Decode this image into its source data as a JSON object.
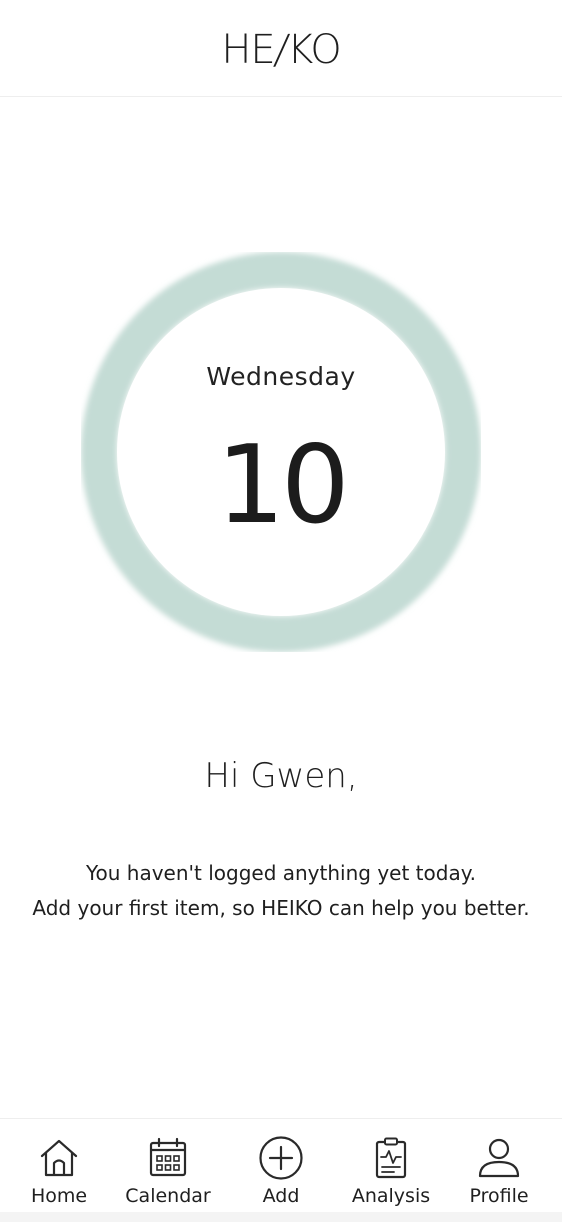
{
  "app": {
    "logo_left": "HE",
    "logo_slash": "/",
    "logo_right": "KO"
  },
  "today": {
    "weekday": "Wednesday",
    "day": "10",
    "ring_color": "#c4dcd5"
  },
  "greeting": "Hi Gwen,",
  "message": {
    "line1": "You haven't logged anything yet today.",
    "line2": "Add your first item, so HEIKO can help you better."
  },
  "tabbar": {
    "items": [
      {
        "label": "Home",
        "icon": "home-icon"
      },
      {
        "label": "Calendar",
        "icon": "calendar-icon"
      },
      {
        "label": "Add",
        "icon": "plus-circle-icon"
      },
      {
        "label": "Analysis",
        "icon": "clipboard-pulse-icon"
      },
      {
        "label": "Profile",
        "icon": "user-icon"
      }
    ]
  }
}
